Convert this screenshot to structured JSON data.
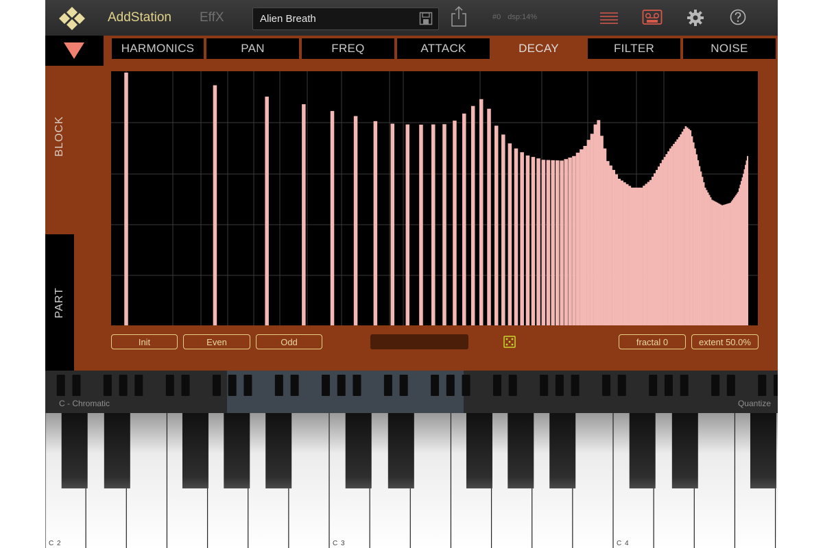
{
  "app": {
    "title": "AddStation",
    "effx_label": "EffX",
    "preset_name": "Alien Breath",
    "status_number": "#0",
    "status_dsp": "dsp:14%"
  },
  "colors": {
    "accent": "#e2d38a",
    "panel": "#8b3a15",
    "bar": "#f4b8b4",
    "tab_bg": "#000000"
  },
  "icons": {
    "logo": "diamond-logo-icon",
    "save": "save-icon",
    "share": "share-icon",
    "menu": "hamburger-menu-icon",
    "tape": "tape-recorder-icon",
    "settings": "gear-icon",
    "help": "help-icon",
    "collapse": "triangle-down-icon",
    "random": "dice-icon"
  },
  "tabs": [
    {
      "label": "HARMONICS",
      "active": false
    },
    {
      "label": "PAN",
      "active": false
    },
    {
      "label": "FREQ",
      "active": false
    },
    {
      "label": "ATTACK",
      "active": false
    },
    {
      "label": "DECAY",
      "active": true
    },
    {
      "label": "FILTER",
      "active": false
    },
    {
      "label": "NOISE",
      "active": false
    }
  ],
  "side": {
    "block_label": "BLOCK",
    "part_label": "PART"
  },
  "buttons": {
    "init": "Init",
    "even": "Even",
    "odd": "Odd",
    "fractal": "fractal 0",
    "extent": "extent 50.0%"
  },
  "keyboard": {
    "scale_label": "C - Chromatic",
    "quantize_label": "Quantize",
    "octave_labels": [
      "C 2",
      "C 3",
      "C 4"
    ]
  },
  "decay_profile": {
    "harmonics": 128,
    "anchors": [
      [
        1,
        1.0
      ],
      [
        2,
        0.95
      ],
      [
        3,
        0.905
      ],
      [
        4,
        0.875
      ],
      [
        5,
        0.848
      ],
      [
        6,
        0.828
      ],
      [
        7,
        0.808
      ],
      [
        8,
        0.798
      ],
      [
        9,
        0.795
      ],
      [
        10,
        0.794
      ],
      [
        11,
        0.795
      ],
      [
        12,
        0.796
      ],
      [
        13,
        0.81
      ],
      [
        14,
        0.838
      ],
      [
        15,
        0.868
      ],
      [
        16,
        0.895
      ],
      [
        17,
        0.857
      ],
      [
        18,
        0.79
      ],
      [
        19,
        0.755
      ],
      [
        20,
        0.72
      ],
      [
        21,
        0.7
      ],
      [
        22,
        0.685
      ],
      [
        23,
        0.672
      ],
      [
        26,
        0.655
      ],
      [
        30,
        0.652
      ],
      [
        33,
        0.67
      ],
      [
        36,
        0.71
      ],
      [
        38,
        0.758
      ],
      [
        39,
        0.795
      ],
      [
        40,
        0.812
      ],
      [
        41,
        0.75
      ],
      [
        43,
        0.65
      ],
      [
        47,
        0.58
      ],
      [
        52,
        0.545
      ],
      [
        56,
        0.545
      ],
      [
        60,
        0.575
      ],
      [
        63,
        0.615
      ],
      [
        66,
        0.655
      ],
      [
        70,
        0.7
      ],
      [
        75,
        0.745
      ],
      [
        79,
        0.788
      ],
      [
        82,
        0.772
      ],
      [
        85,
        0.7
      ],
      [
        88,
        0.63
      ],
      [
        92,
        0.545
      ],
      [
        97,
        0.497
      ],
      [
        105,
        0.475
      ],
      [
        112,
        0.485
      ],
      [
        119,
        0.528
      ],
      [
        124,
        0.6
      ],
      [
        128,
        0.67
      ]
    ]
  }
}
